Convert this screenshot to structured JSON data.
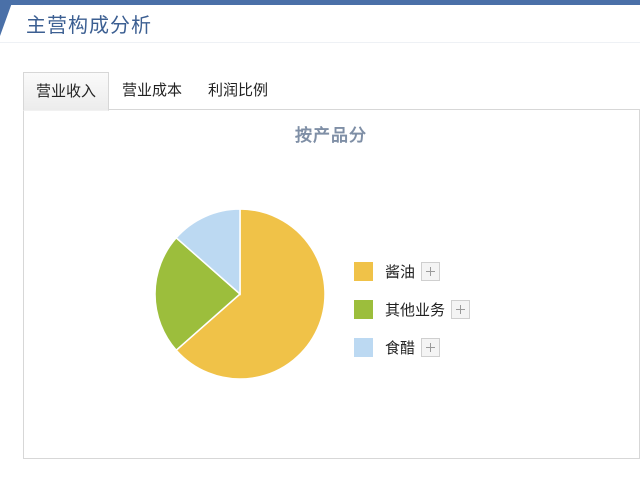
{
  "header": {
    "title": "主营构成分析"
  },
  "tabs": [
    {
      "label": "营业收入",
      "active": true
    },
    {
      "label": "营业成本",
      "active": false
    },
    {
      "label": "利润比例",
      "active": false
    }
  ],
  "colors": {
    "accent": "#4a70a8",
    "title": "#3c5f92"
  },
  "chart_data": {
    "type": "pie",
    "title": "按产品分",
    "categories": [
      "酱油",
      "其他业务",
      "食醋"
    ],
    "values": [
      63.5,
      23.0,
      13.5
    ],
    "colors": [
      "#f0c248",
      "#9cbe3c",
      "#bcd9f2"
    ],
    "legend_position": "right",
    "legend_expand_icon": "plus-icon"
  }
}
